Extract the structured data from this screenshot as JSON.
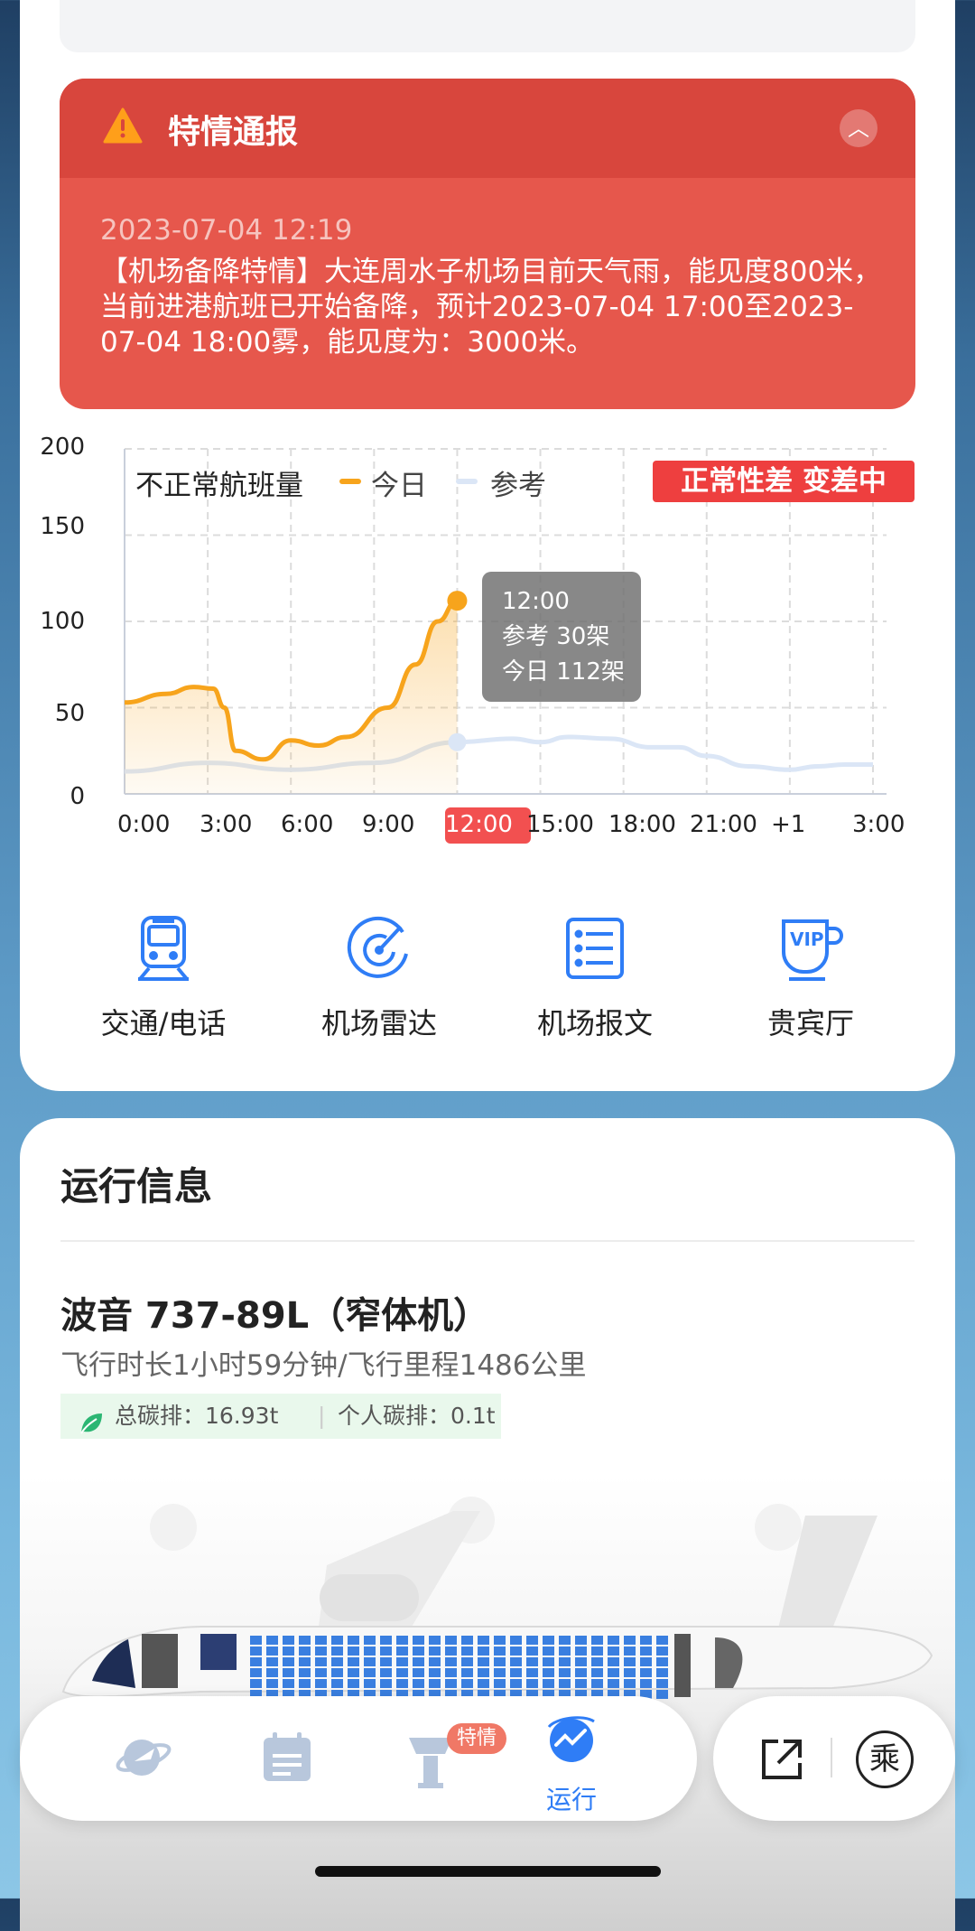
{
  "alert": {
    "title": "特情通报",
    "time": "2023-07-04 12:19",
    "body": "【机场备降特情】大连周水子机场目前天气雨，能见度800米，当前进港航班已开始备降，预计2023-07-04 17:00至2023-07-04 18:00雾，能见度为：3000米。",
    "icon": "warning-triangle-icon",
    "collapse_icon": "chevron-up-icon"
  },
  "chart_data": {
    "type": "line",
    "title": "不正常航班量",
    "x": [
      "0:00",
      "3:00",
      "6:00",
      "9:00",
      "12:00",
      "15:00",
      "18:00",
      "21:00",
      "+1",
      "3:00"
    ],
    "ylim": [
      0,
      200
    ],
    "yticks": [
      "200",
      "150",
      "100",
      "50",
      "0"
    ],
    "series": [
      {
        "name": "今日",
        "color": "#f7a41c",
        "points": [
          [
            0,
            53
          ],
          [
            1.5,
            58
          ],
          [
            2.5,
            62
          ],
          [
            3.2,
            61
          ],
          [
            3.6,
            50
          ],
          [
            4.0,
            25
          ],
          [
            5.0,
            20
          ],
          [
            6.0,
            31
          ],
          [
            7.0,
            28
          ],
          [
            8.0,
            33
          ],
          [
            9.5,
            50
          ],
          [
            10.5,
            75
          ],
          [
            11.3,
            100
          ],
          [
            12,
            112
          ]
        ]
      },
      {
        "name": "参考",
        "color": "#dbe6f6",
        "points": [
          [
            0,
            13
          ],
          [
            3,
            18
          ],
          [
            6,
            14
          ],
          [
            9,
            18
          ],
          [
            12,
            30
          ],
          [
            14,
            32
          ],
          [
            15,
            30
          ],
          [
            16,
            33
          ],
          [
            17.5,
            32
          ],
          [
            19,
            27
          ],
          [
            20,
            27
          ],
          [
            21,
            22
          ],
          [
            22.5,
            16
          ],
          [
            24,
            14
          ],
          [
            25,
            16
          ],
          [
            26,
            17
          ],
          [
            27,
            17
          ]
        ]
      }
    ],
    "highlight_x": "12:00",
    "tooltip": {
      "time": "12:00",
      "ref": "参考 30架",
      "today": "今日 112架"
    },
    "status": "正常性差 变差中",
    "grid": true
  },
  "shortcuts": [
    {
      "label": "交通/电话",
      "icon": "train-icon"
    },
    {
      "label": "机场雷达",
      "icon": "radar-icon"
    },
    {
      "label": "机场报文",
      "icon": "document-list-icon"
    },
    {
      "label": "贵宾厅",
      "icon": "vip-cup-icon"
    }
  ],
  "info": {
    "title": "运行信息",
    "aircraft": "波音 737-89L（窄体机）",
    "meta": "飞行时长1小时59分钟/飞行里程1486公里",
    "carbon_total": "总碳排：16.93t",
    "carbon_personal": "个人碳排：0.1t"
  },
  "nav": {
    "badge": "特情",
    "active_label": "运行",
    "items": [
      "planet-plane-icon",
      "calendar-icon",
      "tower-icon",
      "trend-icon"
    ],
    "share_icon": "share-icon",
    "ride_char": "乘"
  }
}
